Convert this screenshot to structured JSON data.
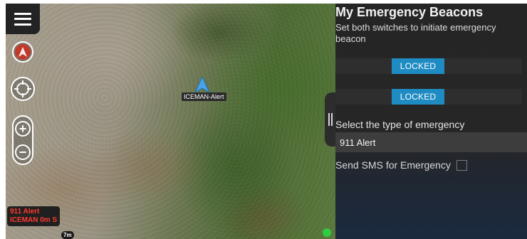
{
  "map": {
    "marker_label": "ICEMAN-Alert",
    "alert_lines": [
      "911 Alert",
      "ICEMAN 0m S"
    ],
    "scale_text": "7m",
    "zoom_in": "+",
    "zoom_out": "−"
  },
  "icons": {
    "menu": "hamburger-menu-icon",
    "compass": "compass-icon",
    "locate": "crosshair-icon",
    "marker": "navigation-arrow-icon",
    "status": "gps-status-icon",
    "drawer": "drawer-handle-icon"
  },
  "panel": {
    "title": "My Emergency Beacons",
    "description": "Set both switches to initiate emergency beacon",
    "switch1_label": "LOCKED",
    "switch2_label": "LOCKED",
    "select_label": "Select the type of emergency",
    "select_value": "911 Alert",
    "sms_label": "Send SMS for Emergency",
    "sms_checked": false
  },
  "colors": {
    "accent": "#1e8bc3",
    "alert_text": "#ff3b30",
    "panel_bg": "#252525"
  }
}
